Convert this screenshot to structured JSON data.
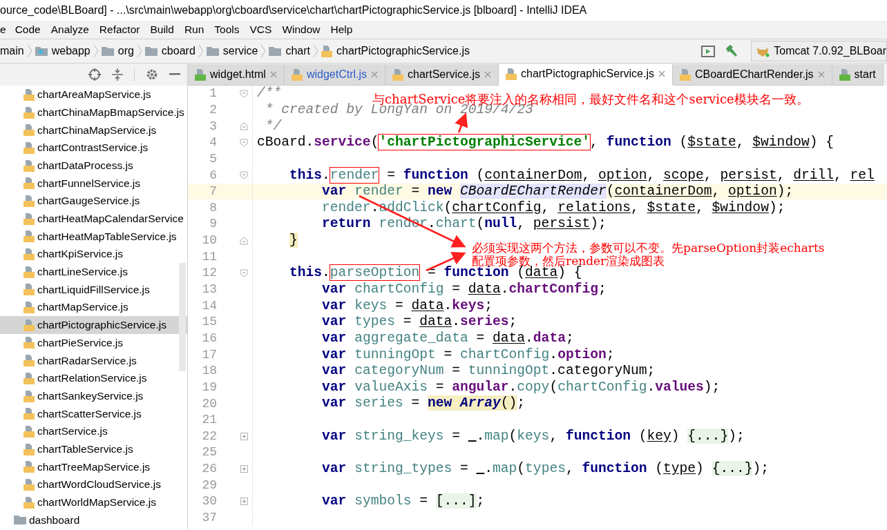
{
  "window": {
    "title": "ource_code\\BLBoard] - ...\\src\\main\\webapp\\org\\cboard\\service\\chart\\chartPictographicService.js [blboard] - IntelliJ IDEA"
  },
  "menu": [
    "e",
    "Code",
    "Analyze",
    "Refactor",
    "Build",
    "Run",
    "Tools",
    "VCS",
    "Window",
    "Help"
  ],
  "breadcrumbs": [
    {
      "label": "main",
      "kind": "plain"
    },
    {
      "label": "webapp",
      "kind": "web"
    },
    {
      "label": "org",
      "kind": "folder"
    },
    {
      "label": "cboard",
      "kind": "folder"
    },
    {
      "label": "service",
      "kind": "folder"
    },
    {
      "label": "chart",
      "kind": "folder"
    },
    {
      "label": "chartPictographicService.js",
      "kind": "js"
    }
  ],
  "run_config": "Tomcat 7.0.92_BLBoar",
  "tabs": [
    {
      "label": "widget.html",
      "kind": "html",
      "selected": false,
      "modified": false,
      "closable": true
    },
    {
      "label": "widgetCtrl.js",
      "kind": "js",
      "selected": false,
      "modified": true,
      "closable": true
    },
    {
      "label": "chartService.js",
      "kind": "js",
      "selected": false,
      "modified": false,
      "closable": true
    },
    {
      "label": "chartPictographicService.js",
      "kind": "js",
      "selected": true,
      "modified": false,
      "closable": true
    },
    {
      "label": "CBoardEChartRender.js",
      "kind": "js",
      "selected": false,
      "modified": false,
      "closable": true
    },
    {
      "label": "start",
      "kind": "html",
      "selected": false,
      "modified": false,
      "closable": false
    }
  ],
  "project_tree": [
    {
      "label": "chartAreaMapService.js",
      "kind": "js",
      "selected": false
    },
    {
      "label": "chartChinaMapBmapService.js",
      "kind": "js",
      "selected": false
    },
    {
      "label": "chartChinaMapService.js",
      "kind": "js",
      "selected": false
    },
    {
      "label": "chartContrastService.js",
      "kind": "js",
      "selected": false
    },
    {
      "label": "chartDataProcess.js",
      "kind": "js",
      "selected": false
    },
    {
      "label": "chartFunnelService.js",
      "kind": "js",
      "selected": false
    },
    {
      "label": "chartGaugeService.js",
      "kind": "js",
      "selected": false
    },
    {
      "label": "chartHeatMapCalendarService",
      "kind": "js",
      "selected": false
    },
    {
      "label": "chartHeatMapTableService.js",
      "kind": "js",
      "selected": false
    },
    {
      "label": "chartKpiService.js",
      "kind": "js",
      "selected": false
    },
    {
      "label": "chartLineService.js",
      "kind": "js",
      "selected": false
    },
    {
      "label": "chartLiquidFillService.js",
      "kind": "js",
      "selected": false
    },
    {
      "label": "chartMapService.js",
      "kind": "js",
      "selected": false
    },
    {
      "label": "chartPictographicService.js",
      "kind": "js",
      "selected": true
    },
    {
      "label": "chartPieService.js",
      "kind": "js",
      "selected": false
    },
    {
      "label": "chartRadarService.js",
      "kind": "js",
      "selected": false
    },
    {
      "label": "chartRelationService.js",
      "kind": "js",
      "selected": false
    },
    {
      "label": "chartSankeyService.js",
      "kind": "js",
      "selected": false
    },
    {
      "label": "chartScatterService.js",
      "kind": "js",
      "selected": false
    },
    {
      "label": "chartService.js",
      "kind": "js",
      "selected": false
    },
    {
      "label": "chartTableService.js",
      "kind": "js",
      "selected": false
    },
    {
      "label": "chartTreeMapService.js",
      "kind": "js",
      "selected": false
    },
    {
      "label": "chartWordCloudService.js",
      "kind": "js",
      "selected": false
    },
    {
      "label": "chartWorldMapService.js",
      "kind": "js",
      "selected": false
    },
    {
      "label": "dashboard",
      "kind": "folder",
      "selected": false
    }
  ],
  "code": [
    {
      "number": "1",
      "kind": "foldopen",
      "current": false,
      "tokens": [
        {
          "kind": "comment",
          "text": "/**"
        }
      ]
    },
    {
      "number": "2",
      "kind": "plain",
      "current": false,
      "tokens": [
        {
          "kind": "comment",
          "text": " * created by LongYan on 2019/4/23"
        }
      ]
    },
    {
      "number": "3",
      "kind": "foldclose",
      "current": false,
      "tokens": [
        {
          "kind": "comment",
          "text": " */"
        }
      ]
    },
    {
      "number": "4",
      "kind": "foldopen",
      "current": false,
      "tokens": [
        {
          "kind": "text",
          "text": "cBoard."
        },
        {
          "kind": "property",
          "text": "service"
        },
        {
          "kind": "text",
          "text": "("
        },
        {
          "kind": "boxedstring",
          "text": "'chartPictographicService'"
        },
        {
          "kind": "text",
          "text": ", "
        },
        {
          "kind": "keyword",
          "text": "function"
        },
        {
          "kind": "text",
          "text": " ("
        },
        {
          "kind": "param",
          "text": "$state"
        },
        {
          "kind": "text",
          "text": ", "
        },
        {
          "kind": "param",
          "text": "$window"
        },
        {
          "kind": "text",
          "text": ") {"
        }
      ]
    },
    {
      "number": "5",
      "kind": "plain",
      "current": false
    },
    {
      "number": "6",
      "kind": "foldopen",
      "current": false,
      "tokens": [
        {
          "kind": "keyword",
          "text": "    this"
        },
        {
          "kind": "text",
          "text": "."
        },
        {
          "kind": "boxedlocal",
          "text": "render"
        },
        {
          "kind": "text",
          "text": " = "
        },
        {
          "kind": "keyword",
          "text": "function"
        },
        {
          "kind": "text",
          "text": " ("
        },
        {
          "kind": "param",
          "text": "containerDom"
        },
        {
          "kind": "text",
          "text": ", "
        },
        {
          "kind": "param",
          "text": "option"
        },
        {
          "kind": "text",
          "text": ", "
        },
        {
          "kind": "param",
          "text": "scope"
        },
        {
          "kind": "text",
          "text": ", "
        },
        {
          "kind": "param",
          "text": "persist"
        },
        {
          "kind": "text",
          "text": ", "
        },
        {
          "kind": "param",
          "text": "drill"
        },
        {
          "kind": "text",
          "text": ", "
        },
        {
          "kind": "param",
          "text": "rel"
        }
      ]
    },
    {
      "number": "7",
      "kind": "plain",
      "current": true,
      "tokens": [
        {
          "kind": "keyword",
          "text": "        var "
        },
        {
          "kind": "local",
          "text": "render"
        },
        {
          "kind": "text",
          "text": " = "
        },
        {
          "kind": "keyword",
          "text": "new "
        },
        {
          "kind": "classref",
          "text": "CBoardEChartRender"
        },
        {
          "kind": "text",
          "text": "("
        },
        {
          "kind": "param",
          "text": "containerDom"
        },
        {
          "kind": "text",
          "text": ", "
        },
        {
          "kind": "param",
          "text": "option"
        },
        {
          "kind": "text",
          "text": ");"
        }
      ]
    },
    {
      "number": "8",
      "kind": "plain",
      "current": false,
      "tokens": [
        {
          "kind": "local",
          "text": "        render"
        },
        {
          "kind": "text",
          "text": "."
        },
        {
          "kind": "local",
          "text": "addClick"
        },
        {
          "kind": "text",
          "text": "("
        },
        {
          "kind": "param",
          "text": "chartConfig"
        },
        {
          "kind": "text",
          "text": ", "
        },
        {
          "kind": "param",
          "text": "relations"
        },
        {
          "kind": "text",
          "text": ", "
        },
        {
          "kind": "param",
          "text": "$state"
        },
        {
          "kind": "text",
          "text": ", "
        },
        {
          "kind": "param",
          "text": "$window"
        },
        {
          "kind": "text",
          "text": ");"
        }
      ]
    },
    {
      "number": "9",
      "kind": "plain",
      "current": false,
      "tokens": [
        {
          "kind": "keyword",
          "text": "        return "
        },
        {
          "kind": "local",
          "text": "render"
        },
        {
          "kind": "text",
          "text": "."
        },
        {
          "kind": "local",
          "text": "chart"
        },
        {
          "kind": "text",
          "text": "("
        },
        {
          "kind": "keyword",
          "text": "null"
        },
        {
          "kind": "text",
          "text": ", "
        },
        {
          "kind": "param",
          "text": "persist"
        },
        {
          "kind": "text",
          "text": ");"
        }
      ]
    },
    {
      "number": "10",
      "kind": "foldclose",
      "current": false,
      "tokens": [
        {
          "kind": "brace",
          "text": "    }"
        }
      ]
    },
    {
      "number": "11",
      "kind": "plain",
      "current": false
    },
    {
      "number": "12",
      "kind": "foldopen",
      "current": false,
      "tokens": [
        {
          "kind": "keyword",
          "text": "    this"
        },
        {
          "kind": "text",
          "text": "."
        },
        {
          "kind": "boxedlocal",
          "text": "parseOption"
        },
        {
          "kind": "text",
          "text": " = "
        },
        {
          "kind": "keyword",
          "text": "function"
        },
        {
          "kind": "text",
          "text": " ("
        },
        {
          "kind": "param",
          "text": "data"
        },
        {
          "kind": "text",
          "text": ") {"
        }
      ]
    },
    {
      "number": "13",
      "kind": "plain",
      "current": false,
      "tokens": [
        {
          "kind": "keyword",
          "text": "        var "
        },
        {
          "kind": "local",
          "text": "chartConfig"
        },
        {
          "kind": "text",
          "text": " = "
        },
        {
          "kind": "param",
          "text": "data"
        },
        {
          "kind": "text",
          "text": "."
        },
        {
          "kind": "property",
          "text": "chartConfig"
        },
        {
          "kind": "text",
          "text": ";"
        }
      ]
    },
    {
      "number": "14",
      "kind": "plain",
      "current": false,
      "tokens": [
        {
          "kind": "keyword",
          "text": "        var "
        },
        {
          "kind": "local",
          "text": "keys"
        },
        {
          "kind": "text",
          "text": " = "
        },
        {
          "kind": "param",
          "text": "data"
        },
        {
          "kind": "text",
          "text": "."
        },
        {
          "kind": "property",
          "text": "keys"
        },
        {
          "kind": "text",
          "text": ";"
        }
      ]
    },
    {
      "number": "15",
      "kind": "plain",
      "current": false,
      "tokens": [
        {
          "kind": "keyword",
          "text": "        var "
        },
        {
          "kind": "local",
          "text": "types"
        },
        {
          "kind": "text",
          "text": " = "
        },
        {
          "kind": "param",
          "text": "data"
        },
        {
          "kind": "text",
          "text": "."
        },
        {
          "kind": "property",
          "text": "series"
        },
        {
          "kind": "text",
          "text": ";"
        }
      ]
    },
    {
      "number": "16",
      "kind": "plain",
      "current": false,
      "tokens": [
        {
          "kind": "keyword",
          "text": "        var "
        },
        {
          "kind": "local",
          "text": "aggregate_data"
        },
        {
          "kind": "text",
          "text": " = "
        },
        {
          "kind": "param",
          "text": "data"
        },
        {
          "kind": "text",
          "text": "."
        },
        {
          "kind": "property",
          "text": "data"
        },
        {
          "kind": "text",
          "text": ";"
        }
      ]
    },
    {
      "number": "17",
      "kind": "plain",
      "current": false,
      "tokens": [
        {
          "kind": "keyword",
          "text": "        var "
        },
        {
          "kind": "local",
          "text": "tunningOpt"
        },
        {
          "kind": "text",
          "text": " = "
        },
        {
          "kind": "local",
          "text": "chartConfig"
        },
        {
          "kind": "text",
          "text": "."
        },
        {
          "kind": "property",
          "text": "option"
        },
        {
          "kind": "text",
          "text": ";"
        }
      ]
    },
    {
      "number": "18",
      "kind": "plain",
      "current": false,
      "tokens": [
        {
          "kind": "keyword",
          "text": "        var "
        },
        {
          "kind": "local",
          "text": "categoryNum"
        },
        {
          "kind": "text",
          "text": " = "
        },
        {
          "kind": "local",
          "text": "tunningOpt"
        },
        {
          "kind": "text",
          "text": ".categoryNum;"
        }
      ]
    },
    {
      "number": "19",
      "kind": "plain",
      "current": false,
      "tokens": [
        {
          "kind": "keyword",
          "text": "        var "
        },
        {
          "kind": "local",
          "text": "valueAxis"
        },
        {
          "kind": "text",
          "text": " = "
        },
        {
          "kind": "property",
          "text": "angular"
        },
        {
          "kind": "text",
          "text": "."
        },
        {
          "kind": "method",
          "text": "copy"
        },
        {
          "kind": "text",
          "text": "("
        },
        {
          "kind": "local",
          "text": "chartConfig"
        },
        {
          "kind": "text",
          "text": "."
        },
        {
          "kind": "property",
          "text": "values"
        },
        {
          "kind": "text",
          "text": ");"
        }
      ]
    },
    {
      "number": "20",
      "kind": "plain",
      "current": false,
      "tokens": [
        {
          "kind": "keyword",
          "text": "        var "
        },
        {
          "kind": "local",
          "text": "series"
        },
        {
          "kind": "text",
          "text": " = "
        },
        {
          "kind": "matchedkeyword",
          "text": "new "
        },
        {
          "kind": "matchedclass",
          "text": "Array"
        },
        {
          "kind": "matchedtext",
          "text": "()"
        },
        {
          "kind": "text",
          "text": ";"
        }
      ]
    },
    {
      "number": "21",
      "kind": "plain",
      "current": false
    },
    {
      "number": "22",
      "kind": "foldcollapsed",
      "current": false,
      "tokens": [
        {
          "kind": "keyword",
          "text": "        var "
        },
        {
          "kind": "local",
          "text": "string_keys"
        },
        {
          "kind": "text",
          "text": " = "
        },
        {
          "kind": "param",
          "text": "_"
        },
        {
          "kind": "text",
          "text": "."
        },
        {
          "kind": "method",
          "text": "map"
        },
        {
          "kind": "text",
          "text": "("
        },
        {
          "kind": "local",
          "text": "keys"
        },
        {
          "kind": "text",
          "text": ", "
        },
        {
          "kind": "keyword",
          "text": "function"
        },
        {
          "kind": "text",
          "text": " ("
        },
        {
          "kind": "param",
          "text": "key"
        },
        {
          "kind": "text",
          "text": ") "
        },
        {
          "kind": "folded",
          "text": "{...}"
        },
        {
          "kind": "text",
          "text": ");"
        }
      ]
    },
    {
      "number": "25",
      "kind": "plain",
      "current": false
    },
    {
      "number": "26",
      "kind": "foldcollapsed",
      "current": false,
      "tokens": [
        {
          "kind": "keyword",
          "text": "        var "
        },
        {
          "kind": "local",
          "text": "string_types"
        },
        {
          "kind": "text",
          "text": " = "
        },
        {
          "kind": "param",
          "text": "_"
        },
        {
          "kind": "text",
          "text": "."
        },
        {
          "kind": "method",
          "text": "map"
        },
        {
          "kind": "text",
          "text": "("
        },
        {
          "kind": "local",
          "text": "types"
        },
        {
          "kind": "text",
          "text": ", "
        },
        {
          "kind": "keyword",
          "text": "function"
        },
        {
          "kind": "text",
          "text": " ("
        },
        {
          "kind": "param",
          "text": "type"
        },
        {
          "kind": "text",
          "text": ") "
        },
        {
          "kind": "folded",
          "text": "{...}"
        },
        {
          "kind": "text",
          "text": ");"
        }
      ]
    },
    {
      "number": "29",
      "kind": "plain",
      "current": false
    },
    {
      "number": "30",
      "kind": "foldcollapsed",
      "current": false,
      "tokens": [
        {
          "kind": "keyword",
          "text": "        var "
        },
        {
          "kind": "local",
          "text": "symbols"
        },
        {
          "kind": "text",
          "text": " = "
        },
        {
          "kind": "folded",
          "text": "[...]"
        },
        {
          "kind": "text",
          "text": ";"
        }
      ]
    },
    {
      "number": "37",
      "kind": "plain",
      "current": false
    }
  ],
  "annotations": [
    {
      "lines": [
        "与chartService将要注入的名称相同，最好文件名和这个service模块名一致。"
      ]
    },
    {
      "lines": [
        "必须实现这两个方法，参数可以不变。先parseOption封装echarts",
        "配置项参数，然后render渲染成图表"
      ]
    }
  ]
}
